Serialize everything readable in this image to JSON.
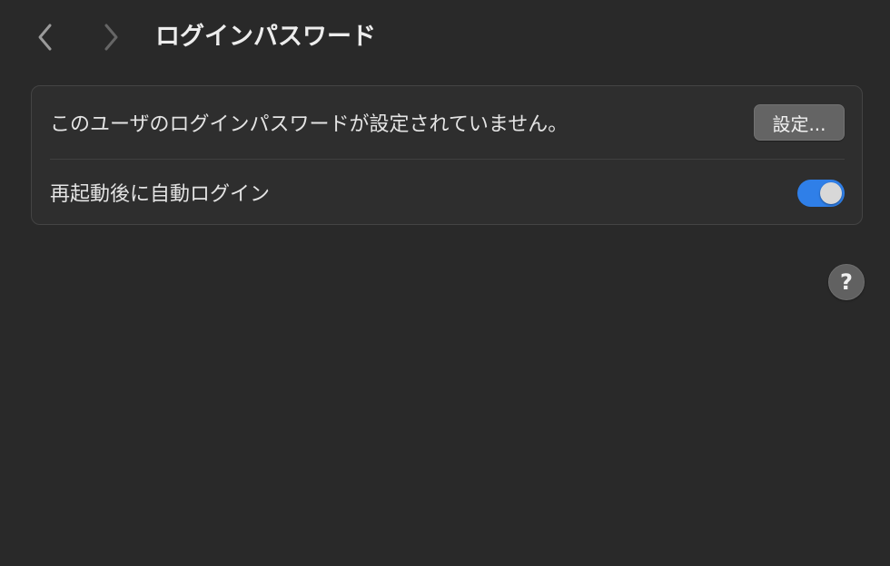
{
  "toolbar": {
    "title": "ログインパスワード",
    "back_icon": "chevron-left-icon",
    "forward_icon": "chevron-right-icon"
  },
  "settings": {
    "password_row": {
      "label": "このユーザのログインパスワードが設定されていません。",
      "button_label": "設定..."
    },
    "auto_login_row": {
      "label": "再起動後に自動ログイン",
      "toggle_on": true
    }
  },
  "help": {
    "label": "?",
    "icon": "question-mark-icon"
  },
  "colors": {
    "background": "#292929",
    "card_background": "#2e2e2e",
    "toggle_accent": "#2f7fe8",
    "button_background": "#646464"
  }
}
